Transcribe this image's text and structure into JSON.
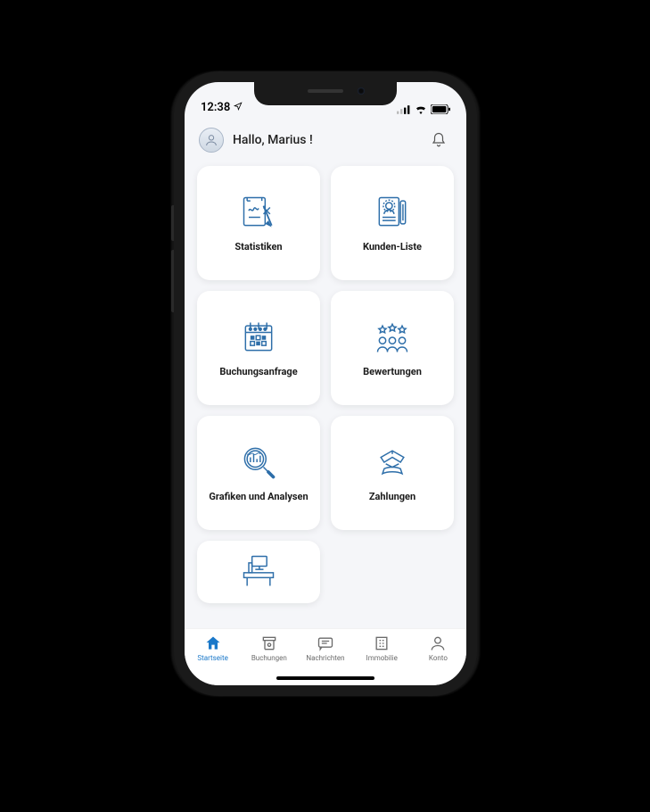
{
  "status": {
    "time": "12:38",
    "location_icon": true
  },
  "header": {
    "greeting": "Hallo, Marius !"
  },
  "cards": [
    {
      "id": "statistiken",
      "label": "Statistiken",
      "icon": "stats-icon"
    },
    {
      "id": "kundenliste",
      "label": "Kunden-Liste",
      "icon": "customer-list-icon"
    },
    {
      "id": "buchungsanfrage",
      "label": "Buchungsanfrage",
      "icon": "booking-request-icon"
    },
    {
      "id": "bewertungen",
      "label": "Bewertungen",
      "icon": "reviews-icon"
    },
    {
      "id": "grafiken",
      "label": "Grafiken und Analysen",
      "icon": "analytics-icon"
    },
    {
      "id": "zahlungen",
      "label": "Zahlungen",
      "icon": "payments-icon"
    },
    {
      "id": "desk",
      "label": "",
      "icon": "desk-icon"
    }
  ],
  "nav": [
    {
      "id": "startseite",
      "label": "Startseite",
      "icon": "home-icon",
      "active": true
    },
    {
      "id": "buchungen",
      "label": "Buchungen",
      "icon": "bookings-icon",
      "active": false
    },
    {
      "id": "nachrichten",
      "label": "Nachrichten",
      "icon": "messages-icon",
      "active": false
    },
    {
      "id": "immobilie",
      "label": "Immobilie",
      "icon": "property-icon",
      "active": false
    },
    {
      "id": "konto",
      "label": "Konto",
      "icon": "account-icon",
      "active": false
    }
  ],
  "colors": {
    "accent": "#2d6ea9"
  }
}
